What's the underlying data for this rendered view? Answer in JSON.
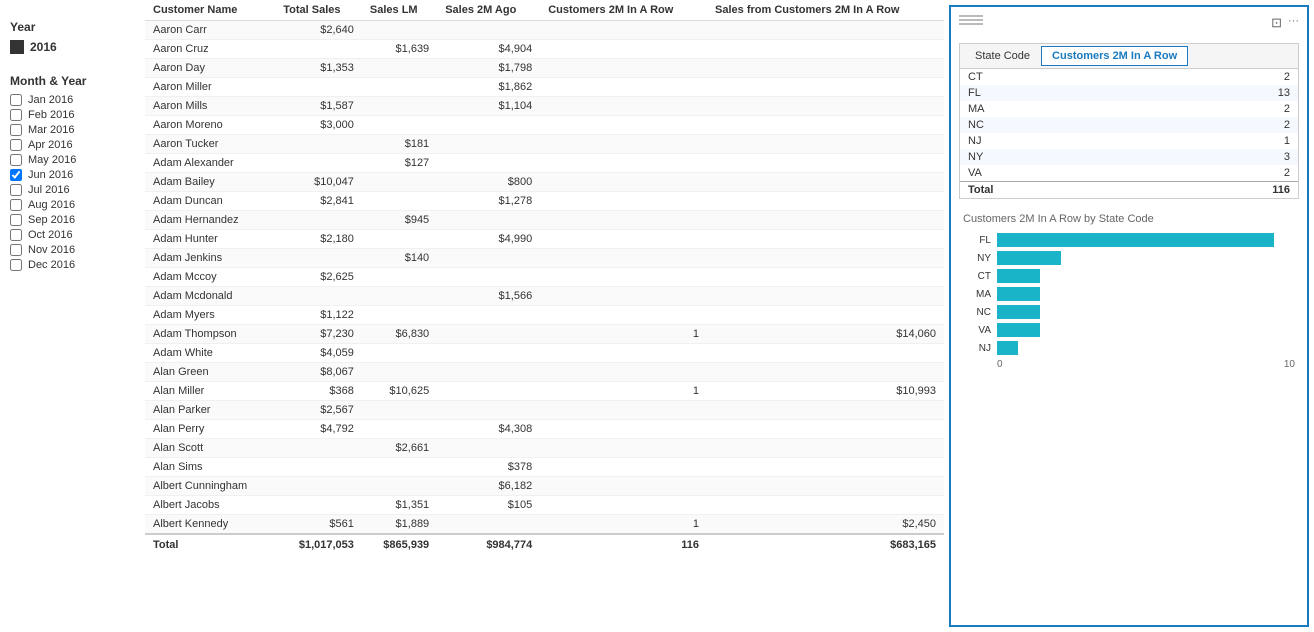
{
  "filters": {
    "year_label": "Year",
    "year_value": "2016",
    "month_label": "Month & Year",
    "months": [
      {
        "label": "Jan 2016",
        "checked": false
      },
      {
        "label": "Feb 2016",
        "checked": false
      },
      {
        "label": "Mar 2016",
        "checked": false
      },
      {
        "label": "Apr 2016",
        "checked": false
      },
      {
        "label": "May 2016",
        "checked": false
      },
      {
        "label": "Jun 2016",
        "checked": true
      },
      {
        "label": "Jul 2016",
        "checked": false
      },
      {
        "label": "Aug 2016",
        "checked": false
      },
      {
        "label": "Sep 2016",
        "checked": false
      },
      {
        "label": "Oct 2016",
        "checked": false
      },
      {
        "label": "Nov 2016",
        "checked": false
      },
      {
        "label": "Dec 2016",
        "checked": false
      }
    ]
  },
  "table": {
    "columns": [
      "Customer Name",
      "Total Sales",
      "Sales LM",
      "Sales 2M Ago",
      "Customers 2M In A Row",
      "Sales from Customers 2M In A Row"
    ],
    "rows": [
      [
        "Aaron Carr",
        "$2,640",
        "",
        "",
        "",
        ""
      ],
      [
        "Aaron Cruz",
        "",
        "$1,639",
        "$4,904",
        "",
        ""
      ],
      [
        "Aaron Day",
        "$1,353",
        "",
        "$1,798",
        "",
        ""
      ],
      [
        "Aaron Miller",
        "",
        "",
        "$1,862",
        "",
        ""
      ],
      [
        "Aaron Mills",
        "$1,587",
        "",
        "$1,104",
        "",
        ""
      ],
      [
        "Aaron Moreno",
        "$3,000",
        "",
        "",
        "",
        ""
      ],
      [
        "Aaron Tucker",
        "",
        "$181",
        "",
        "",
        ""
      ],
      [
        "Adam Alexander",
        "",
        "$127",
        "",
        "",
        ""
      ],
      [
        "Adam Bailey",
        "$10,047",
        "",
        "$800",
        "",
        ""
      ],
      [
        "Adam Duncan",
        "$2,841",
        "",
        "$1,278",
        "",
        ""
      ],
      [
        "Adam Hernandez",
        "",
        "$945",
        "",
        "",
        ""
      ],
      [
        "Adam Hunter",
        "$2,180",
        "",
        "$4,990",
        "",
        ""
      ],
      [
        "Adam Jenkins",
        "",
        "$140",
        "",
        "",
        ""
      ],
      [
        "Adam Mccoy",
        "$2,625",
        "",
        "",
        "",
        ""
      ],
      [
        "Adam Mcdonald",
        "",
        "",
        "$1,566",
        "",
        ""
      ],
      [
        "Adam Myers",
        "$1,122",
        "",
        "",
        "",
        ""
      ],
      [
        "Adam Thompson",
        "$7,230",
        "$6,830",
        "",
        "1",
        "$14,060"
      ],
      [
        "Adam White",
        "$4,059",
        "",
        "",
        "",
        ""
      ],
      [
        "Alan Green",
        "$8,067",
        "",
        "",
        "",
        ""
      ],
      [
        "Alan Miller",
        "$368",
        "$10,625",
        "",
        "1",
        "$10,993"
      ],
      [
        "Alan Parker",
        "$2,567",
        "",
        "",
        "",
        ""
      ],
      [
        "Alan Perry",
        "$4,792",
        "",
        "$4,308",
        "",
        ""
      ],
      [
        "Alan Scott",
        "",
        "$2,661",
        "",
        "",
        ""
      ],
      [
        "Alan Sims",
        "",
        "",
        "$378",
        "",
        ""
      ],
      [
        "Albert Cunningham",
        "",
        "",
        "$6,182",
        "",
        ""
      ],
      [
        "Albert Jacobs",
        "",
        "$1,351",
        "$105",
        "",
        ""
      ],
      [
        "Albert Kennedy",
        "$561",
        "$1,889",
        "",
        "1",
        "$2,450"
      ]
    ],
    "footer": [
      "Total",
      "$1,017,053",
      "$865,939",
      "$984,774",
      "116",
      "$683,165"
    ]
  },
  "right_panel": {
    "widget_tab1": "State Code",
    "widget_tab2": "Customers 2M In A Row",
    "state_table": {
      "columns": [
        "State Code",
        "Customers 2M In A Row"
      ],
      "rows": [
        [
          "CT",
          "2"
        ],
        [
          "FL",
          "13"
        ],
        [
          "MA",
          "2"
        ],
        [
          "NC",
          "2"
        ],
        [
          "NJ",
          "1"
        ],
        [
          "NY",
          "3"
        ],
        [
          "VA",
          "2"
        ]
      ],
      "footer": [
        "Total",
        "116"
      ]
    },
    "chart_title": "Customers 2M In A Row by State Code",
    "chart_bars": [
      {
        "label": "FL",
        "value": 13,
        "max": 14
      },
      {
        "label": "NY",
        "value": 3,
        "max": 14
      },
      {
        "label": "CT",
        "value": 2,
        "max": 14
      },
      {
        "label": "MA",
        "value": 2,
        "max": 14
      },
      {
        "label": "NC",
        "value": 2,
        "max": 14
      },
      {
        "label": "VA",
        "value": 2,
        "max": 14
      },
      {
        "label": "NJ",
        "value": 1,
        "max": 14
      }
    ],
    "chart_axis_min": "0",
    "chart_axis_max": "10"
  }
}
